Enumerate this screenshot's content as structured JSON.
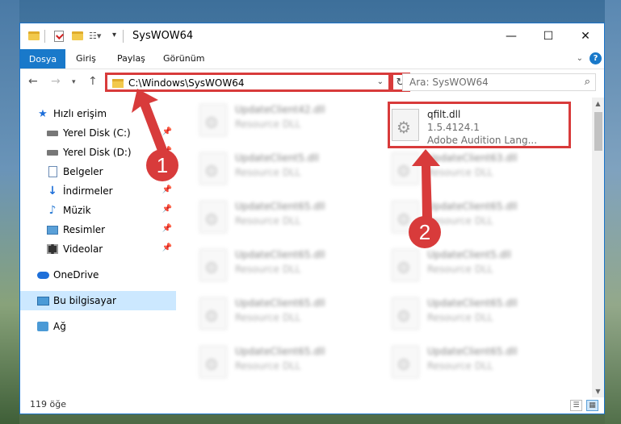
{
  "window": {
    "title": "SysWOW64",
    "minimize": "—",
    "maximize": "☐",
    "close": "✕"
  },
  "ribbon": {
    "tabs": [
      "Dosya",
      "Giriş",
      "Paylaş",
      "Görünüm"
    ],
    "help": "?"
  },
  "address": {
    "path": "C:\\Windows\\SysWOW64",
    "search_placeholder": "Ara: SysWOW64"
  },
  "sidebar": {
    "items": [
      {
        "label": "Hızlı erişim",
        "icon": "star-icon"
      },
      {
        "label": "Yerel Disk (C:)",
        "icon": "drive-icon",
        "pinned": true
      },
      {
        "label": "Yerel Disk (D:)",
        "icon": "drive-icon",
        "pinned": true
      },
      {
        "label": "Belgeler",
        "icon": "document-icon"
      },
      {
        "label": "İndirmeler",
        "icon": "download-icon",
        "pinned": true
      },
      {
        "label": "Müzik",
        "icon": "music-icon",
        "pinned": true
      },
      {
        "label": "Resimler",
        "icon": "pictures-icon",
        "pinned": true
      },
      {
        "label": "Videolar",
        "icon": "videos-icon",
        "pinned": true
      },
      {
        "label": "OneDrive",
        "icon": "cloud-icon"
      },
      {
        "label": "Bu bilgisayar",
        "icon": "computer-icon",
        "selected": true
      },
      {
        "label": "Ağ",
        "icon": "network-icon"
      }
    ]
  },
  "files": {
    "highlighted": {
      "name": "qfilt.dll",
      "version": "1.5.4124.1",
      "description": "Adobe Audition Lang..."
    },
    "blurred_left": [
      {
        "name": "UpdateClient42.dll",
        "type": "Resource DLL"
      },
      {
        "name": "UpdateClient5.dll",
        "type": "Resource DLL"
      },
      {
        "name": "UpdateClient65.dll",
        "type": "Resource DLL"
      },
      {
        "name": "UpdateClient65.dll",
        "type": "Resource DLL"
      },
      {
        "name": "UpdateClient65.dll",
        "type": "Resource DLL"
      },
      {
        "name": "UpdateClient65.dll",
        "type": "Resource DLL"
      }
    ],
    "blurred_right": [
      {
        "name": "UpdateClient63.dll",
        "type": "Resource DLL"
      },
      {
        "name": "UpdateClient65.dll",
        "type": "Resource DLL"
      },
      {
        "name": "UpdateClient5.dll",
        "type": "Resource DLL"
      },
      {
        "name": "UpdateClient65.dll",
        "type": "Resource DLL"
      },
      {
        "name": "UpdateClient65.dll",
        "type": "Resource DLL"
      }
    ]
  },
  "status": {
    "count": "119 öğe"
  },
  "annotations": {
    "badge1": "1",
    "badge2": "2",
    "color": "#d83b3b"
  }
}
